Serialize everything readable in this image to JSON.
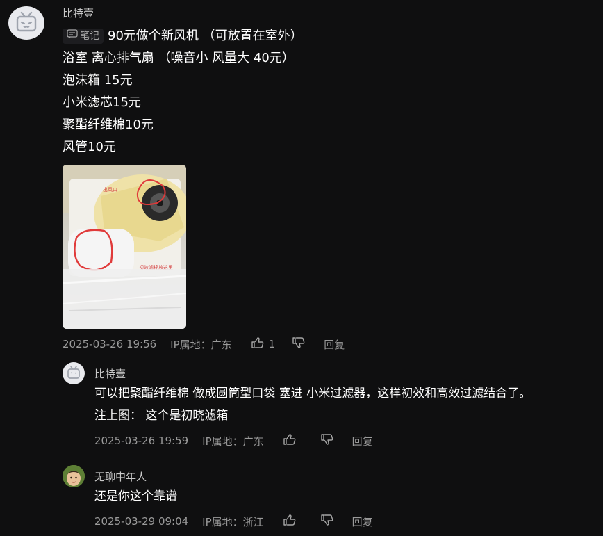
{
  "comment": {
    "user": "比特壹",
    "note_badge": "笔记",
    "lines": [
      "90元做个新风机 （可放置在室外）",
      "浴室 离心排气扇 （噪音小 风量大 40元）",
      "泡沫箱 15元",
      "小米滤芯15元",
      "聚酯纤维棉10元",
      "风管10元"
    ],
    "photo_annotations": [
      "出风口",
      "初效滤棉放这里"
    ],
    "date": "2025-03-26 19:56",
    "ip": "IP属地：广东",
    "likes": "1",
    "reply_label": "回复"
  },
  "replies": [
    {
      "user": "比特壹",
      "lines": [
        "可以把聚酯纤维棉 做成圆筒型口袋 塞进 小米过滤器，这样初效和高效过滤结合了。",
        "注上图： 这个是初晓滤箱"
      ],
      "date": "2025-03-26 19:59",
      "ip": "IP属地：广东",
      "reply_label": "回复"
    },
    {
      "user": "无聊中年人",
      "lines": [
        "还是你这个靠谱"
      ],
      "date": "2025-03-29 09:04",
      "ip": "IP属地：浙江",
      "reply_label": "回复"
    }
  ],
  "icons": {
    "like": "thumbs-up-icon",
    "dislike": "thumbs-down-icon",
    "note": "note-icon"
  }
}
